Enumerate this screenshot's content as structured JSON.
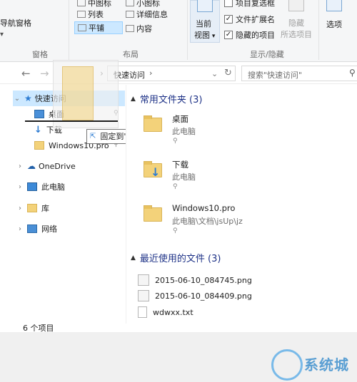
{
  "ribbon": {
    "nav_pane_label": "导航窗格",
    "pane_group_label": "窗格",
    "layout": {
      "group_label": "布局",
      "items": [
        "中图标",
        "小图标",
        "列表",
        "详细信息",
        "平铺",
        "内容"
      ]
    },
    "current_view": {
      "label_line1": "当前",
      "label_line2": "视图"
    },
    "show_hide": {
      "group_label": "显示/隐藏",
      "item_checkboxes": "项目复选框",
      "file_extensions": "文件扩展名",
      "hidden_items": "隐藏的项目",
      "hide_label": "隐藏",
      "hide_selected": "所选项目"
    },
    "options_label": "选项"
  },
  "navbar": {
    "address_text": "快速访问",
    "search_placeholder": "搜索\"快速访问\""
  },
  "left_pane": {
    "items": [
      {
        "label": "快速访问"
      },
      {
        "label": "桌面"
      },
      {
        "label": "下载"
      },
      {
        "label": "Windows10.pro"
      },
      {
        "label": "OneDrive"
      },
      {
        "label": "此电脑"
      },
      {
        "label": "库"
      },
      {
        "label": "网络"
      }
    ]
  },
  "drag": {
    "tooltip": "固定到\"快速访问\""
  },
  "right_pane": {
    "frequent": {
      "header": "常用文件夹 (3)",
      "tiles": [
        {
          "title": "桌面",
          "sub": "此电脑"
        },
        {
          "title": "下载",
          "sub": "此电脑"
        },
        {
          "title": "Windows10.pro",
          "sub": "此电脑\\文档\\jsUp\\jz"
        }
      ]
    },
    "recent": {
      "header": "最近使用的文件 (3)",
      "files": [
        {
          "name": "2015-06-10_084745.png"
        },
        {
          "name": "2015-06-10_084409.png"
        },
        {
          "name": "wdwxx.txt"
        }
      ]
    }
  },
  "status": {
    "count_text": "6 个项目"
  },
  "watermark": {
    "text": "系统城"
  },
  "colors": {
    "accent": "#1e3287",
    "selection": "#cce8ff",
    "folder": "#f3d27a"
  }
}
